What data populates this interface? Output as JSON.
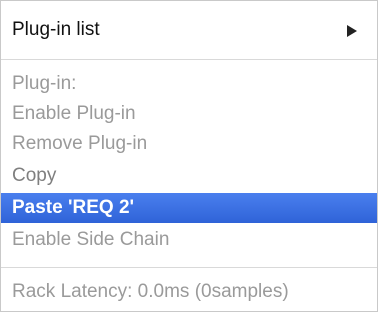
{
  "menu": {
    "header": {
      "label": "Plug-in list",
      "submenu_icon": "triangle-right-icon"
    },
    "items": [
      {
        "label": "Plug-in:",
        "enabled": false
      },
      {
        "label": "Enable Plug-in",
        "enabled": false
      },
      {
        "label": "Remove Plug-in",
        "enabled": false
      },
      {
        "label": "Copy",
        "enabled": true
      },
      {
        "label": "Paste 'REQ 2'",
        "enabled": true,
        "highlighted": true
      },
      {
        "label": "Enable Side Chain",
        "enabled": false
      }
    ],
    "footer": {
      "latency_label": "Rack Latency: 0.0ms (0samples)"
    }
  },
  "colors": {
    "highlight": "#3a6fe0",
    "disabled_text": "#9a9a9a",
    "header_text": "#111111"
  }
}
